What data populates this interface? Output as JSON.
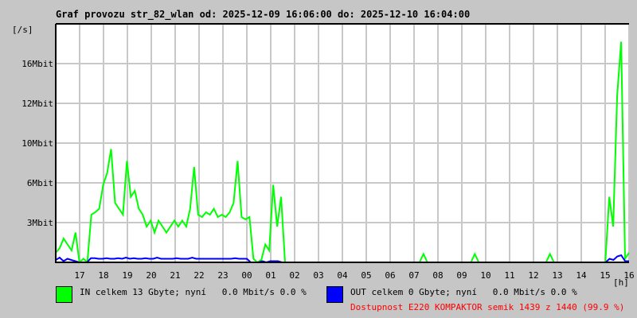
{
  "title": "Graf provozu str_82_wlan od: 2025-12-09 16:06:00 do: 2025-12-10 16:04:00",
  "legend": {
    "in": {
      "label": "IN celkem 13 Gbyte; nyní   0.0 Mbit/s 0.0 %",
      "color": "#00ff00"
    },
    "out": {
      "label": "OUT celkem 0 Gbyte; nyní   0.0 Mbit/s 0.0 %",
      "color": "#0000ff"
    },
    "availability": {
      "label": "Dostupnost E220 KOMPAKTOR semik 1439 z 1440 (99.9 %)",
      "color": "#ff0000"
    }
  },
  "chart_data": {
    "type": "line",
    "title": "Graf provozu str_82_wlan od: 2025-12-09 16:06:00 do: 2025-12-10 16:04:00",
    "ylabel": "[/s]",
    "xlabel": "[h]",
    "ylim": [
      0,
      20
    ],
    "y_unit": "Mbit/s",
    "yticks": [
      {
        "value": 3.33,
        "label": "3Mbit"
      },
      {
        "value": 6.67,
        "label": "6Mbit"
      },
      {
        "value": 10,
        "label": "10Mbit"
      },
      {
        "value": 13.33,
        "label": "12Mbit"
      },
      {
        "value": 16.67,
        "label": "16Mbit"
      }
    ],
    "xticks": [
      "17",
      "18",
      "19",
      "20",
      "21",
      "22",
      "23",
      "00",
      "01",
      "02",
      "03",
      "04",
      "05",
      "06",
      "07",
      "08",
      "09",
      "10",
      "11",
      "12",
      "13",
      "14",
      "15",
      "16"
    ],
    "x_start_hour_offset": 0,
    "sample_minutes": 10,
    "grid": true,
    "series": [
      {
        "name": "IN",
        "color": "#00ff00",
        "values": [
          0.8,
          1.2,
          2.0,
          1.5,
          1.0,
          2.5,
          0,
          0.3,
          0,
          4.0,
          4.2,
          4.5,
          6.5,
          7.5,
          9.5,
          5.0,
          4.5,
          4.0,
          8.5,
          5.5,
          6.0,
          4.5,
          4.0,
          3.0,
          3.5,
          2.5,
          3.5,
          3.0,
          2.5,
          3.0,
          3.5,
          3.0,
          3.5,
          3.0,
          4.5,
          8.0,
          4.0,
          3.8,
          4.2,
          4.0,
          4.5,
          3.8,
          4.0,
          3.8,
          4.2,
          5.0,
          8.5,
          3.8,
          3.6,
          3.8,
          0.3,
          0,
          0.2,
          1.5,
          1.0,
          6.5,
          3.0,
          5.5,
          0,
          0,
          0,
          0,
          0,
          0,
          0,
          0,
          0,
          0,
          0,
          0,
          0,
          0,
          0,
          0,
          0,
          0,
          0,
          0,
          0,
          0,
          0,
          0,
          0,
          0,
          0,
          0,
          0,
          0,
          0,
          0,
          0,
          0,
          0,
          0.7,
          0,
          0,
          0,
          0,
          0,
          0,
          0,
          0,
          0,
          0,
          0,
          0,
          0.7,
          0,
          0,
          0,
          0,
          0,
          0,
          0,
          0,
          0,
          0,
          0,
          0,
          0,
          0,
          0,
          0,
          0,
          0,
          0.7,
          0,
          0,
          0,
          0,
          0,
          0,
          0,
          0,
          0,
          0,
          0,
          0,
          0,
          0,
          5.5,
          3.0,
          14.0,
          18.5,
          0.3,
          0.8
        ]
      },
      {
        "name": "OUT",
        "color": "#0000ff",
        "values": [
          0.2,
          0.4,
          0.1,
          0.3,
          0.2,
          0.1,
          0,
          0,
          0,
          0.35,
          0.35,
          0.3,
          0.3,
          0.35,
          0.3,
          0.3,
          0.35,
          0.3,
          0.4,
          0.3,
          0.35,
          0.3,
          0.3,
          0.35,
          0.3,
          0.3,
          0.4,
          0.3,
          0.3,
          0.3,
          0.3,
          0.35,
          0.3,
          0.3,
          0.3,
          0.4,
          0.3,
          0.3,
          0.3,
          0.3,
          0.3,
          0.3,
          0.3,
          0.3,
          0.3,
          0.3,
          0.35,
          0.3,
          0.3,
          0.3,
          0,
          0,
          0,
          0.1,
          0,
          0.1,
          0.1,
          0.1,
          0,
          0,
          0,
          0,
          0,
          0,
          0,
          0,
          0,
          0,
          0,
          0,
          0,
          0,
          0,
          0,
          0,
          0,
          0,
          0,
          0,
          0,
          0,
          0,
          0,
          0,
          0,
          0,
          0,
          0,
          0,
          0,
          0,
          0,
          0,
          0,
          0,
          0,
          0,
          0,
          0,
          0,
          0,
          0,
          0,
          0,
          0,
          0,
          0,
          0,
          0,
          0,
          0,
          0,
          0,
          0,
          0,
          0,
          0,
          0,
          0,
          0,
          0,
          0,
          0,
          0,
          0,
          0,
          0,
          0,
          0,
          0,
          0,
          0,
          0,
          0,
          0,
          0,
          0,
          0,
          0,
          0,
          0,
          0,
          0.3,
          0.2,
          0.5,
          0.6,
          0.1,
          0.1
        ]
      }
    ]
  }
}
